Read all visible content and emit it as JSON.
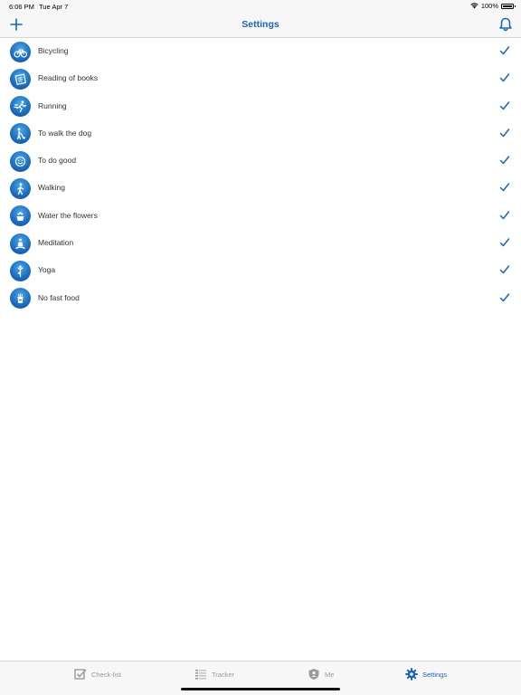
{
  "status_bar": {
    "time": "6:06 PM",
    "date": "Tue Apr 7",
    "battery": "100%",
    "battery_level": 1.0
  },
  "nav": {
    "title": "Settings"
  },
  "activities": [
    {
      "label": "Bicycling",
      "icon": "bicycle-icon",
      "checked": true
    },
    {
      "label": "Reading of books",
      "icon": "book-icon",
      "checked": true
    },
    {
      "label": "Running",
      "icon": "running-icon",
      "checked": true
    },
    {
      "label": "To walk the dog",
      "icon": "dog-walk-icon",
      "checked": true
    },
    {
      "label": "To do good",
      "icon": "smile-icon",
      "checked": true
    },
    {
      "label": "Walking",
      "icon": "walking-icon",
      "checked": true
    },
    {
      "label": "Water the flowers",
      "icon": "flower-icon",
      "checked": true
    },
    {
      "label": "Meditation",
      "icon": "meditation-icon",
      "checked": true
    },
    {
      "label": "Yoga",
      "icon": "yoga-icon",
      "checked": true
    },
    {
      "label": "No fast food",
      "icon": "fast-food-icon",
      "checked": true
    }
  ],
  "tabs": [
    {
      "label": "Check-list",
      "icon": "checklist-icon",
      "active": false
    },
    {
      "label": "Tracker",
      "icon": "tracker-icon",
      "active": false
    },
    {
      "label": "Me",
      "icon": "shield-icon",
      "active": false
    },
    {
      "label": "Settings",
      "icon": "gear-icon",
      "active": true
    }
  ],
  "colors": {
    "accent": "#1a66b3",
    "inactive": "#9b9b9b",
    "icon_bg": "#1f6fc0"
  }
}
